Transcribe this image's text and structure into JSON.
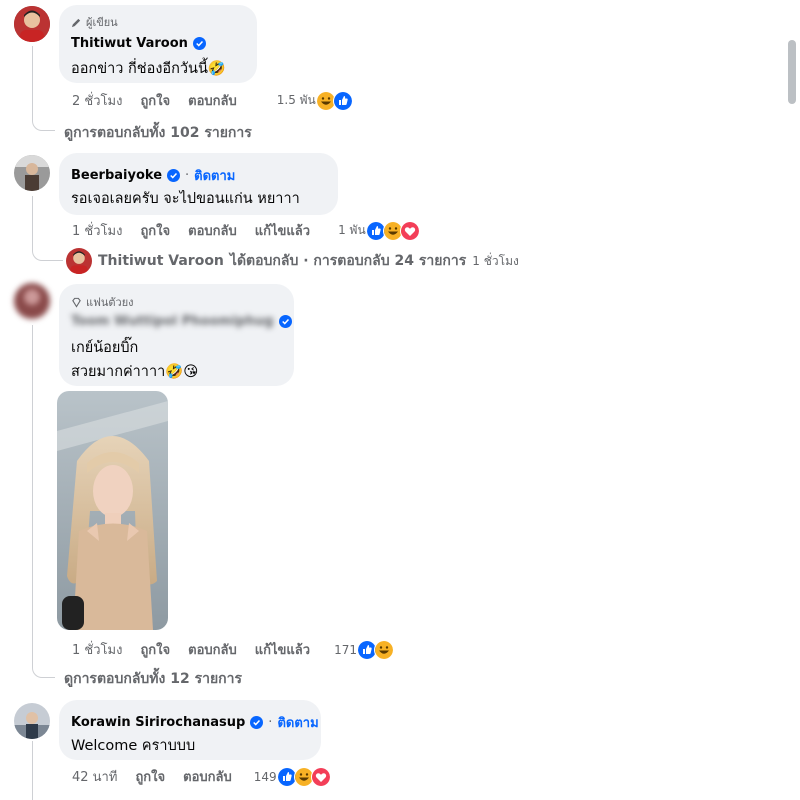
{
  "comments": [
    {
      "badge": "ผู้เขียน",
      "badge_icon": "pencil-icon",
      "author": "Thitiwut Varoon",
      "verified": true,
      "text": "ออกข่าว กี่ช่องอีกวันนี้🤣",
      "time": "2 ชั่วโมง",
      "like": "ถูกใจ",
      "reply": "ตอบกลับ",
      "reaction_count": "1.5 พัน",
      "reactions": [
        "haha-icon",
        "like-icon"
      ],
      "view_replies": "ดูการตอบกลับทั้ง 102 รายการ"
    },
    {
      "author": "Beerbaiyoke",
      "verified": true,
      "follow": "ติดตาม",
      "text": "รอเจอเลยครับ จะไปขอนแก่น หยาาา",
      "time": "1 ชั่วโมง",
      "like": "ถูกใจ",
      "reply": "ตอบกลับ",
      "edited": "แก้ไขแล้ว",
      "reaction_count": "1 พัน",
      "reactions": [
        "like-icon",
        "haha-icon",
        "love-icon"
      ],
      "reply_preview": {
        "author": "Thitiwut Varoon",
        "text": "ได้ตอบกลับ · การตอบกลับ 24 รายการ",
        "time": "1 ชั่วโมง"
      }
    },
    {
      "badge": "แฟนตัวยง",
      "badge_icon": "diamond-icon",
      "author": "Toom Wuttipol Phoomiphug",
      "verified": true,
      "text_line1": "เกย์น้อยบิ๊ก",
      "text_line2": "สวยมากค่าาาา🤣😘",
      "time": "1 ชั่วโมง",
      "like": "ถูกใจ",
      "reply": "ตอบกลับ",
      "edited": "แก้ไขแล้ว",
      "reaction_count": "171",
      "reactions": [
        "like-icon",
        "haha-icon"
      ],
      "view_replies": "ดูการตอบกลับทั้ง 12 รายการ"
    },
    {
      "author": "Korawin Sirirochanasup",
      "verified": true,
      "follow": "ติดตาม",
      "text": "Welcome คราบบบ",
      "time": "42 นาที",
      "like": "ถูกใจ",
      "reply": "ตอบกลับ",
      "reaction_count": "149",
      "reactions": [
        "like-icon",
        "haha-icon",
        "love-icon"
      ]
    }
  ],
  "colors": {
    "bubble": "#f0f2f5",
    "link": "#0866ff",
    "meta": "#65676b",
    "like": "#0866ff",
    "love": "#f33e58",
    "haha": "#f7b125"
  }
}
